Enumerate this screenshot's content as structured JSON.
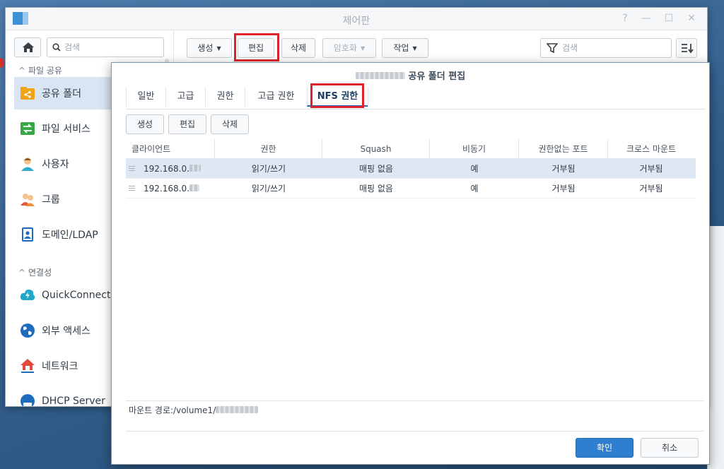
{
  "window": {
    "title": "제어판",
    "help_glyph": "?",
    "minimize_glyph": "—",
    "maximize_glyph": "☐",
    "close_glyph": "✕"
  },
  "sidebar": {
    "search_placeholder": "검색",
    "sections": [
      {
        "label": "파일 공유"
      },
      {
        "label": "연결성"
      }
    ],
    "items": [
      {
        "label": "공유 폴더",
        "icon": "shared-folder-icon",
        "active": true
      },
      {
        "label": "파일 서비스",
        "icon": "file-services-icon"
      },
      {
        "label": "사용자",
        "icon": "user-icon"
      },
      {
        "label": "그룹",
        "icon": "group-icon"
      },
      {
        "label": "도메인/LDAP",
        "icon": "domain-ldap-icon"
      },
      {
        "label": "QuickConnect",
        "icon": "quickconnect-icon"
      },
      {
        "label": "외부 액세스",
        "icon": "external-access-icon"
      },
      {
        "label": "네트워크",
        "icon": "network-icon"
      },
      {
        "label": "DHCP Server",
        "icon": "dhcp-server-icon"
      }
    ]
  },
  "toolbar": {
    "create": "생성",
    "edit": "편집",
    "delete": "삭제",
    "encryption": "암호화",
    "action": "작업",
    "search_placeholder": "검색"
  },
  "dialog": {
    "title": "공유 폴더 편집",
    "tabs": [
      "일반",
      "고급",
      "권한",
      "고급 권한",
      "NFS 권한"
    ],
    "active_tab": "NFS 권한",
    "buttons": {
      "create": "생성",
      "edit": "편집",
      "delete": "삭제"
    },
    "columns": [
      "클라이언트",
      "권한",
      "Squash",
      "비동기",
      "권한없는 포트",
      "크로스 마운트"
    ],
    "rows": [
      {
        "client": "192.168.0.",
        "permission": "읽기/쓰기",
        "squash": "매핑 없음",
        "async": "예",
        "nonpriv": "거부됨",
        "crossmnt": "거부됨",
        "selected": true
      },
      {
        "client": "192.168.0.",
        "permission": "읽기/쓰기",
        "squash": "매핑 없음",
        "async": "예",
        "nonpriv": "거부됨",
        "crossmnt": "거부됨",
        "selected": false
      }
    ],
    "mount_path_label": "마운트 경로:/volume1/",
    "ok": "확인",
    "cancel": "취소"
  },
  "colors": {
    "highlight_box": "#e0232b",
    "primary": "#2f7fd0",
    "selection": "#dde8f4"
  }
}
